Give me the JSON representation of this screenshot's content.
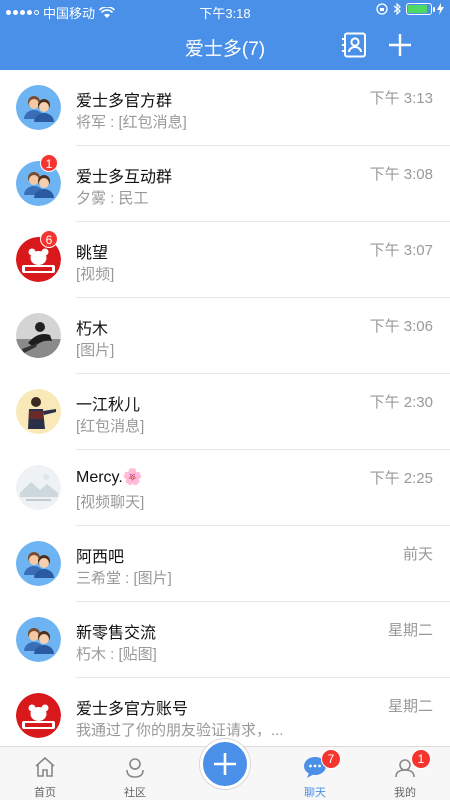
{
  "statusbar": {
    "carrier": "中国移动",
    "time": "下午3:18"
  },
  "header": {
    "title": "爱士多(7)"
  },
  "chats": [
    {
      "name": "爱士多官方群",
      "time": "下午 3:13",
      "preview": "将军 : [红包消息]",
      "avatar": "group-avatar",
      "badge": ""
    },
    {
      "name": "爱士多互动群",
      "time": "下午 3:08",
      "preview": "夕雾 : 民工",
      "avatar": "group-avatar",
      "badge": "1"
    },
    {
      "name": "眺望",
      "time": "下午 3:07",
      "preview": "[视频]",
      "avatar": "store-logo-avatar",
      "badge": "6"
    },
    {
      "name": "朽木",
      "time": "下午 3:06",
      "preview": "[图片]",
      "avatar": "photo-avatar",
      "badge": ""
    },
    {
      "name": "一江秋儿",
      "time": "下午 2:30",
      "preview": "[红包消息]",
      "avatar": "photo-avatar",
      "badge": ""
    },
    {
      "name": "Mercy.🌸",
      "time": "下午 2:25",
      "preview": "[视频聊天]",
      "avatar": "photo-avatar",
      "badge": ""
    },
    {
      "name": "阿西吧",
      "time": "前天",
      "preview": "三希堂 : [图片]",
      "avatar": "group-avatar",
      "badge": ""
    },
    {
      "name": "新零售交流",
      "time": "星期二",
      "preview": "朽木 : [贴图]",
      "avatar": "group-avatar",
      "badge": ""
    },
    {
      "name": "爱士多官方账号",
      "time": "星期二",
      "preview": "我通过了你的朋友验证请求，...",
      "avatar": "store-logo-avatar",
      "badge": ""
    }
  ],
  "tabs": {
    "home": {
      "label": "首页",
      "icon": "home-icon"
    },
    "community": {
      "label": "社区",
      "icon": "community-icon"
    },
    "chat": {
      "label": "聊天",
      "icon": "chat-icon",
      "badge": "7"
    },
    "me": {
      "label": "我的",
      "icon": "profile-icon",
      "badge": "1"
    }
  },
  "colors": {
    "brand": "#4a90e8",
    "badge": "#f43530"
  }
}
